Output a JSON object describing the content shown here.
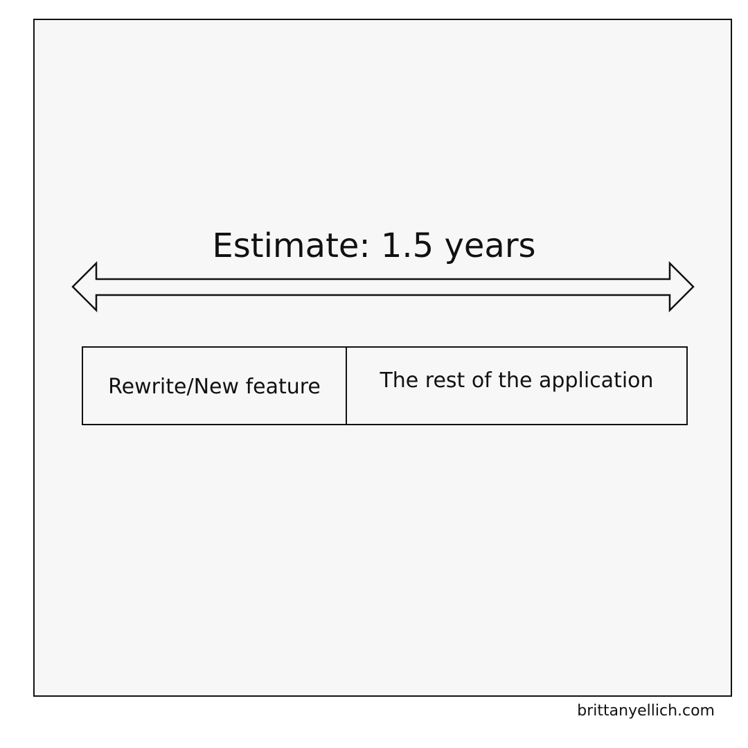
{
  "panel": {
    "estimate_label": "Estimate: 1.5 years",
    "bar": {
      "left_segment": "Rewrite/New feature",
      "right_segment": "The rest of the application"
    }
  },
  "footer": {
    "credit": "brittanyellich.com"
  },
  "colors": {
    "ink": "#111111",
    "panel_background": "#f7f7f7",
    "page_background": "#ffffff"
  }
}
